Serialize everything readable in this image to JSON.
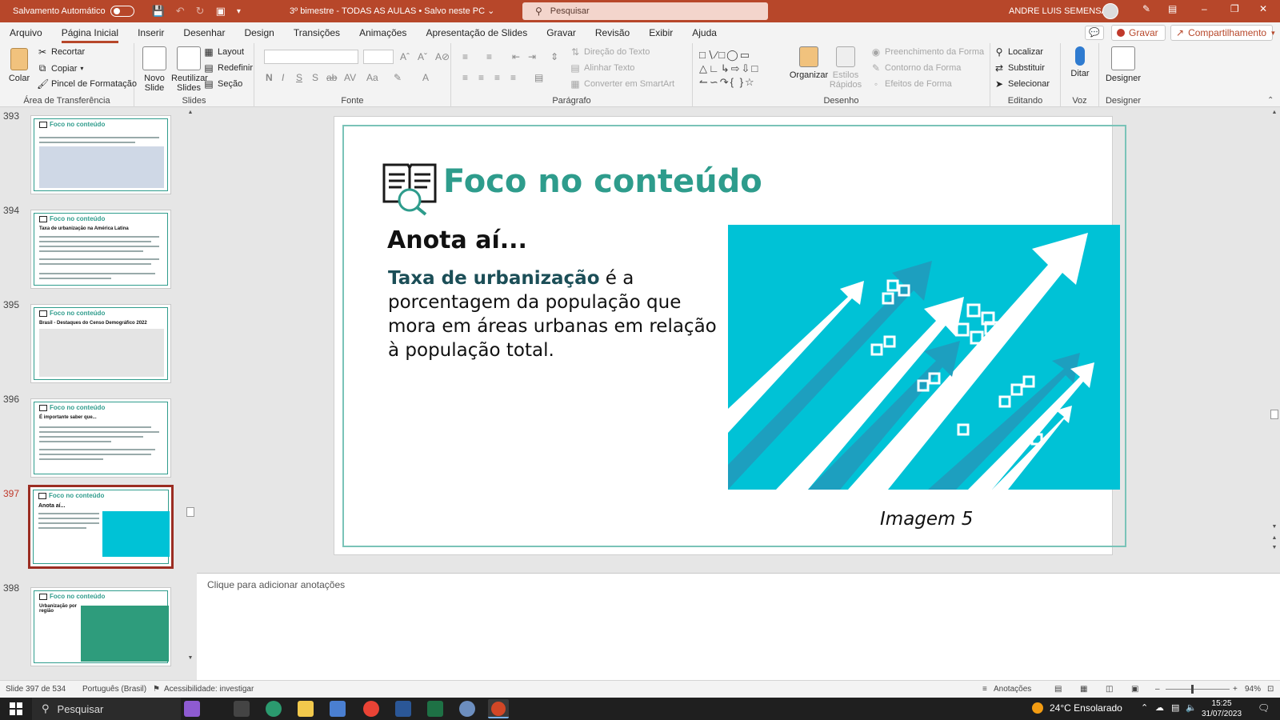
{
  "titlebar": {
    "autosave_label": "Salvamento Automático",
    "doc_title": "3º bimestre - TODAS AS AULAS  •  Salvo neste PC ⌄",
    "search_placeholder": "Pesquisar",
    "user_name": "ANDRE LUIS SEMENSATO"
  },
  "tabs": [
    "Arquivo",
    "Página Inicial",
    "Inserir",
    "Desenhar",
    "Design",
    "Transições",
    "Animações",
    "Apresentação de Slides",
    "Gravar",
    "Revisão",
    "Exibir",
    "Ajuda"
  ],
  "right_buttons": {
    "record": "Gravar",
    "share": "Compartilhamento"
  },
  "ribbon": {
    "clipboard": {
      "label": "Área de Transferência",
      "paste": "Colar",
      "cut": "Recortar",
      "copy": "Copiar",
      "format_painter": "Pincel de Formatação"
    },
    "slides": {
      "label": "Slides",
      "new_slide_1": "Novo",
      "new_slide_2": "Slide",
      "reuse_1": "Reutilizar",
      "reuse_2": "Slides",
      "layout": "Layout",
      "reset": "Redefinir",
      "section": "Seção"
    },
    "font": {
      "label": "Fonte"
    },
    "paragraph": {
      "label": "Parágrafo",
      "text_direction": "Direção do Texto",
      "align_text": "Alinhar Texto",
      "smartart": "Converter em SmartArt"
    },
    "drawing": {
      "label": "Desenho",
      "arrange": "Organizar",
      "quick_styles_1": "Estilos",
      "quick_styles_2": "Rápidos",
      "shape_fill": "Preenchimento da Forma",
      "shape_outline": "Contorno da Forma",
      "shape_effects": "Efeitos de Forma"
    },
    "editing": {
      "label": "Editando",
      "find": "Localizar",
      "replace": "Substituir",
      "select": "Selecionar"
    },
    "voice": {
      "label": "Voz",
      "dictate": "Ditar"
    },
    "designer": {
      "label": "Designer",
      "designer_btn": "Designer"
    }
  },
  "thumbnails": [
    {
      "number": "393",
      "title": "Foco no conteúdo",
      "subtitle": ""
    },
    {
      "number": "394",
      "title": "Foco no conteúdo",
      "subtitle": "Taxa de urbanização na América Latina"
    },
    {
      "number": "395",
      "title": "Foco no conteúdo",
      "subtitle": "Brasil - Destaques do Censo Demográfico 2022"
    },
    {
      "number": "396",
      "title": "Foco no conteúdo",
      "subtitle": "É importante saber que..."
    },
    {
      "number": "397",
      "title": "Foco no conteúdo",
      "subtitle": "Anota aí..."
    },
    {
      "number": "398",
      "title": "Foco no conteúdo",
      "subtitle": "Urbanização por região"
    }
  ],
  "slide": {
    "title": "Foco no conteúdo",
    "subtitle": "Anota aí...",
    "body_term": "Taxa de urbanização",
    "body_rest": " é a porcentagem da população que mora em áreas urbanas em relação à população total.",
    "caption": "Imagem 5",
    "image_color": "#00c2d6",
    "title_color": "#2e9c8c"
  },
  "notes_placeholder": "Clique para adicionar anotações",
  "status": {
    "slide_count": "Slide 397 de 534",
    "language": "Português (Brasil)",
    "accessibility": "Acessibilidade: investigar",
    "notes": "Anotações",
    "zoom": "94%"
  },
  "taskbar": {
    "search": "Pesquisar",
    "weather": "24°C  Ensolarado",
    "time": "15:25",
    "date": "31/07/2023"
  }
}
